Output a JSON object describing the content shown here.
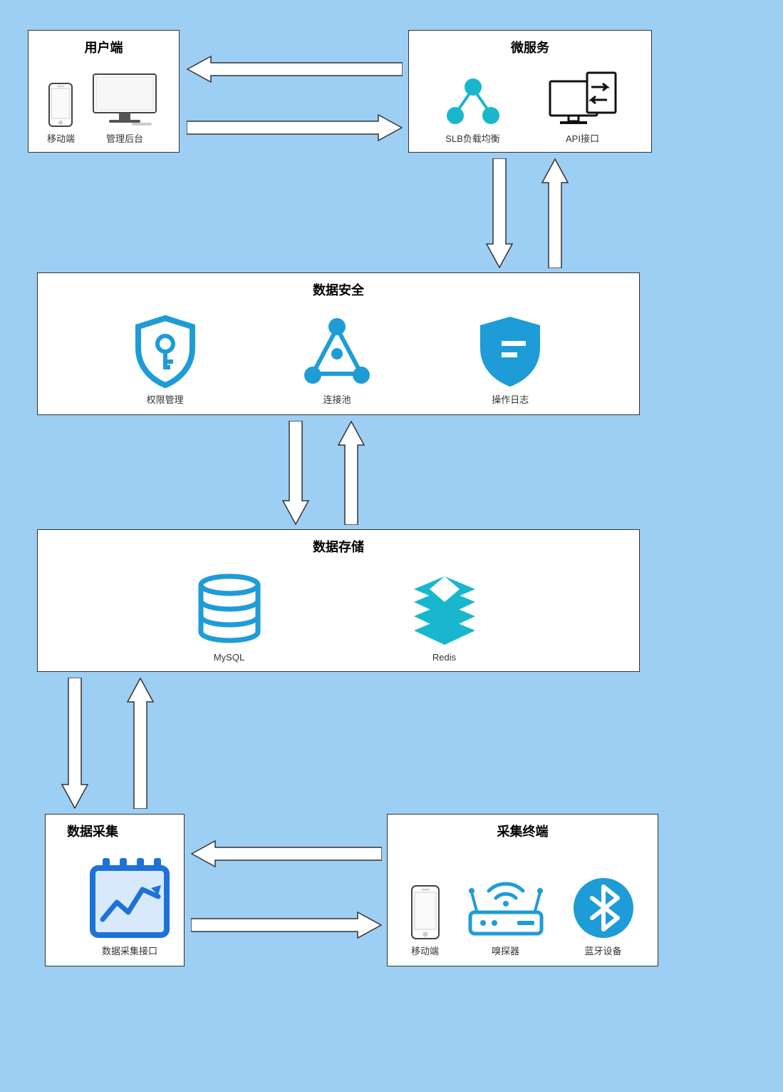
{
  "boxes": {
    "client": {
      "title": "用户端",
      "items": [
        {
          "label": "移动端"
        },
        {
          "label": "管理后台"
        }
      ]
    },
    "microservice": {
      "title": "微服务",
      "items": [
        {
          "label": "SLB负载均衡"
        },
        {
          "label": "API接口"
        }
      ]
    },
    "security": {
      "title": "数据安全",
      "items": [
        {
          "label": "权限管理"
        },
        {
          "label": "连接池"
        },
        {
          "label": "操作日志"
        }
      ]
    },
    "storage": {
      "title": "数据存储",
      "items": [
        {
          "label": "MySQL"
        },
        {
          "label": "Redis"
        }
      ]
    },
    "collect": {
      "title": "数据采集",
      "items": [
        {
          "label": "数据采集接口"
        }
      ]
    },
    "terminal": {
      "title": "采集终端",
      "items": [
        {
          "label": "移动端"
        },
        {
          "label": "嗅探器"
        },
        {
          "label": "蓝牙设备"
        }
      ]
    }
  },
  "colors": {
    "accent": "#1e9cd7",
    "accent2": "#18b7cd"
  }
}
